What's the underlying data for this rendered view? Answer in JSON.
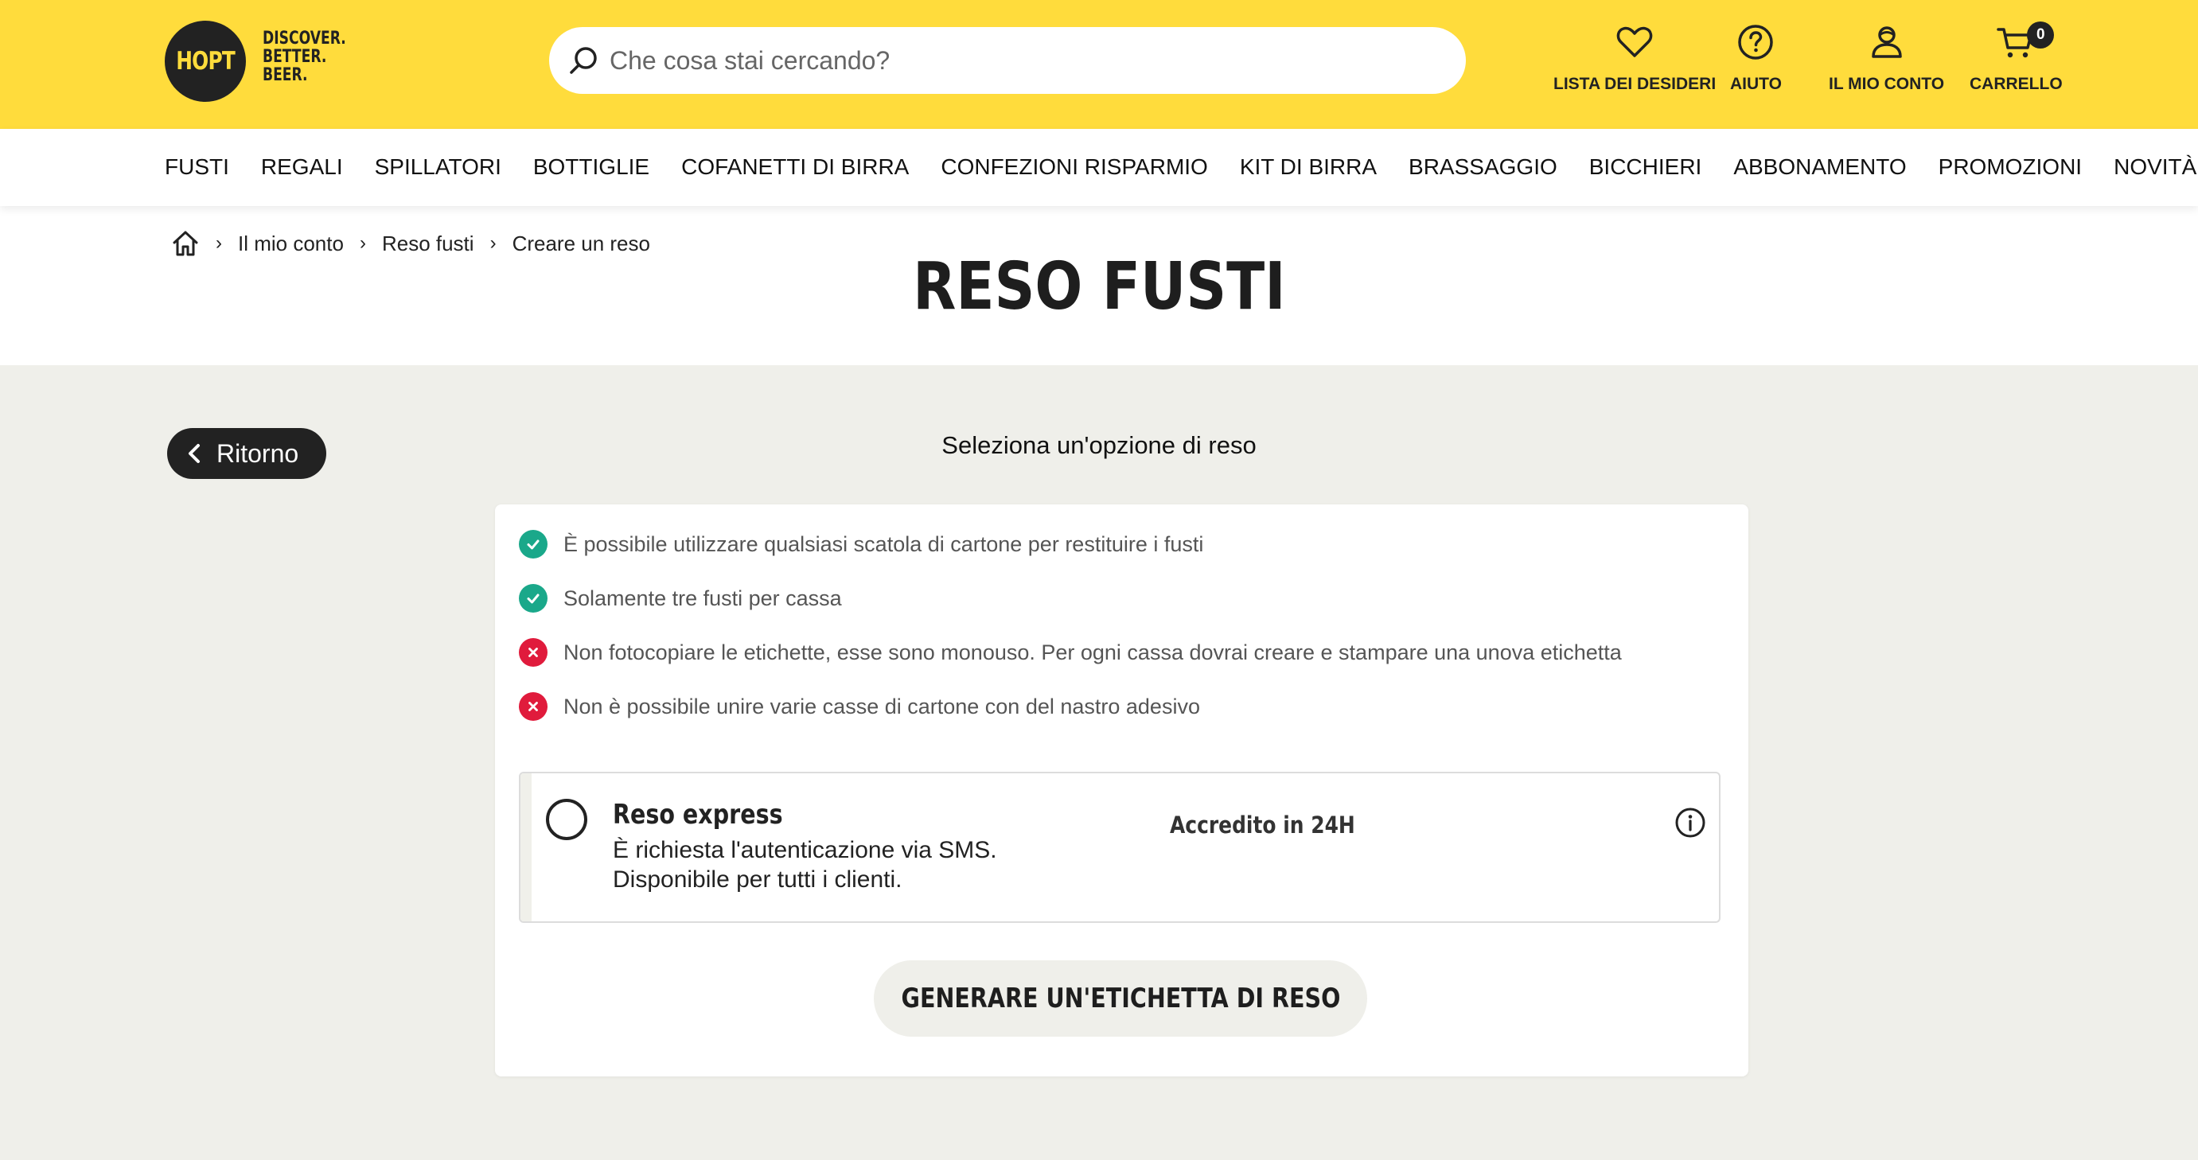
{
  "header": {
    "logo_text": "HOPT",
    "tagline": [
      "DISCOVER.",
      "BETTER.",
      "BEER."
    ],
    "search_placeholder": "Che cosa stai cercando?",
    "actions": {
      "wishlist": "LISTA DEI DESIDERI",
      "help": "AIUTO",
      "account": "IL MIO CONTO",
      "cart": "CARRELLO",
      "cart_count": "0"
    },
    "colors": {
      "brand_yellow": "#ffdc3c",
      "dark": "#222222"
    }
  },
  "nav": {
    "items": [
      "FUSTI",
      "REGALI",
      "SPILLATORI",
      "BOTTIGLIE",
      "COFANETTI DI BIRRA",
      "CONFEZIONI RISPARMIO",
      "KIT DI BIRRA",
      "BRASSAGGIO",
      "BICCHIERI",
      "ABBONAMENTO",
      "PROMOZIONI",
      "NOVITÀ"
    ]
  },
  "breadcrumb": {
    "home_icon": "home-icon",
    "items": [
      "Il mio conto",
      "Reso fusti",
      "Creare un reso"
    ]
  },
  "page": {
    "title": "RESO FUSTI",
    "back_label": "Ritorno",
    "subtitle": "Seleziona un'opzione di reso"
  },
  "rules": [
    {
      "type": "ok",
      "text": "È possibile utilizzare qualsiasi scatola di cartone per restituire i fusti"
    },
    {
      "type": "ok",
      "text": "Solamente tre fusti per cassa"
    },
    {
      "type": "no",
      "text": "Non fotocopiare le etichette, esse sono monouso. Per ogni cassa dovrai creare e stampare una unova etichetta"
    },
    {
      "type": "no",
      "text": "Non è possibile unire varie casse di cartone con del nastro adesivo"
    }
  ],
  "rule_colors": {
    "ok": "#1aa88a",
    "no": "#e01b3c"
  },
  "option": {
    "name": "Reso express",
    "desc_line1": "È richiesta l'autenticazione via SMS.",
    "desc_line2": "Disponibile per tutti i clienti.",
    "credit": "Accredito in 24H",
    "selected": false
  },
  "cta_label": "GENERARE UN'ETICHETTA DI RESO"
}
